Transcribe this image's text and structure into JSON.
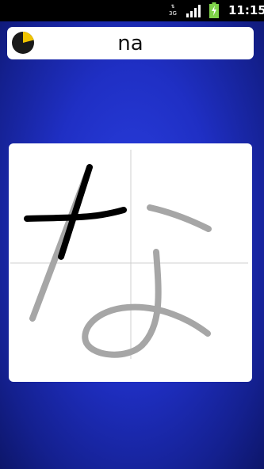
{
  "status_bar": {
    "network_type": "3G",
    "time": "11:15"
  },
  "header": {
    "kana_romaji": "na",
    "timer_icon": "pie-timer-icon",
    "timer_fill_color": "#f0c400"
  },
  "canvas": {
    "guide_stroke_color": "#a6a6a6",
    "drawn_stroke_color": "#000000",
    "character": "な"
  }
}
